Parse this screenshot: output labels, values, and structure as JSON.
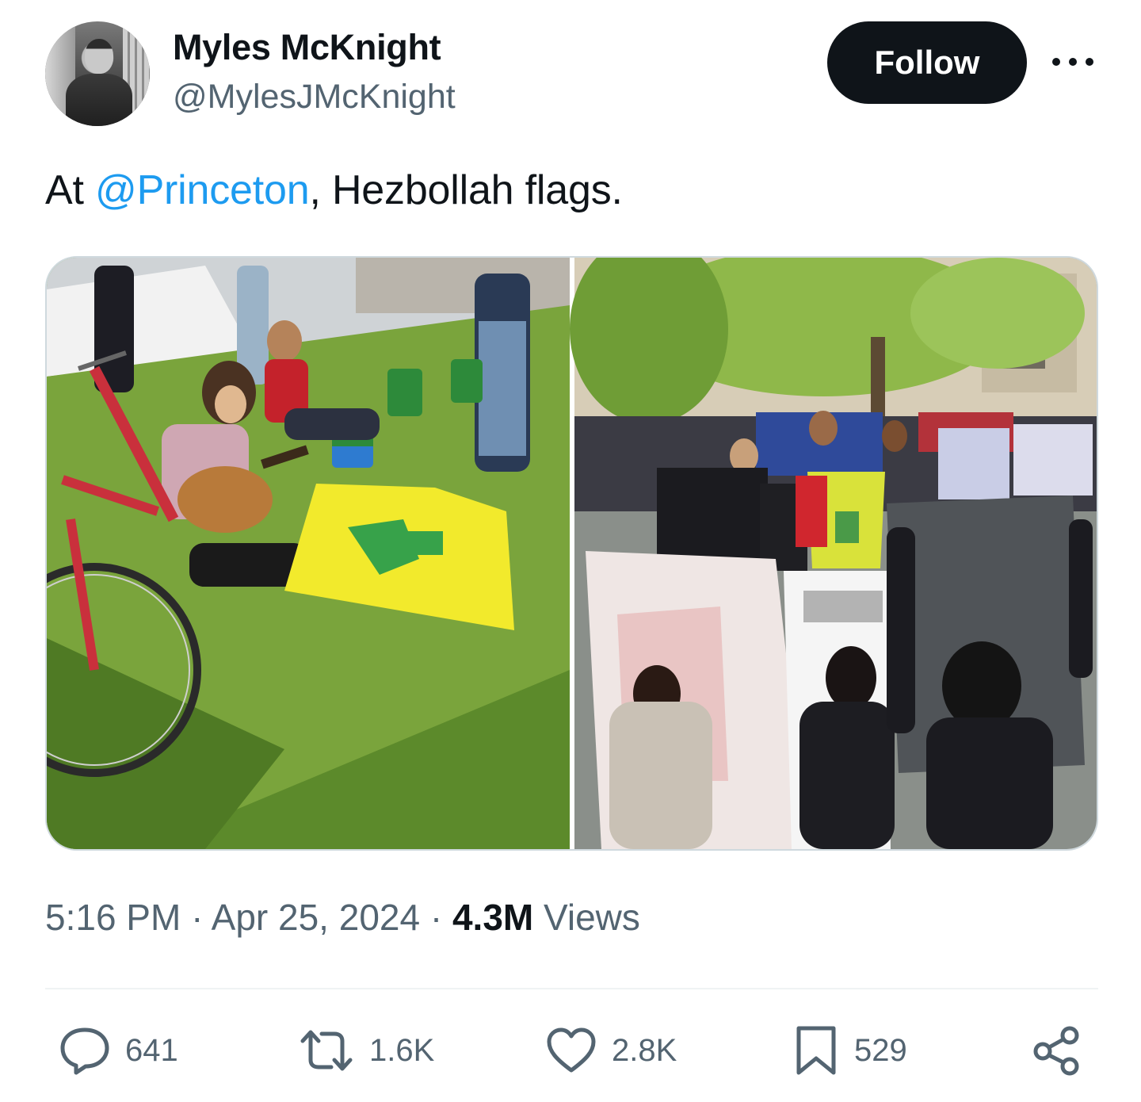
{
  "author": {
    "name": "Myles McKnight",
    "handle": "@MylesJMcKnight"
  },
  "follow_label": "Follow",
  "tweet": {
    "text_prefix": "At ",
    "mention": "@Princeton",
    "text_suffix": ", Hezbollah flags."
  },
  "meta": {
    "time": "5:16 PM",
    "separator": " · ",
    "date": "Apr 25, 2024",
    "views_count": "4.3M",
    "views_label": "Views"
  },
  "actions": {
    "replies": "641",
    "reposts": "1.6K",
    "likes": "2.8K",
    "bookmarks": "529"
  },
  "colors": {
    "accent": "#1d9bf0",
    "text": "#0f1419",
    "secondary": "#536471",
    "follow_bg": "#0f1419"
  },
  "icons": [
    "more-icon",
    "reply-icon",
    "repost-icon",
    "like-icon",
    "bookmark-icon",
    "share-icon"
  ]
}
